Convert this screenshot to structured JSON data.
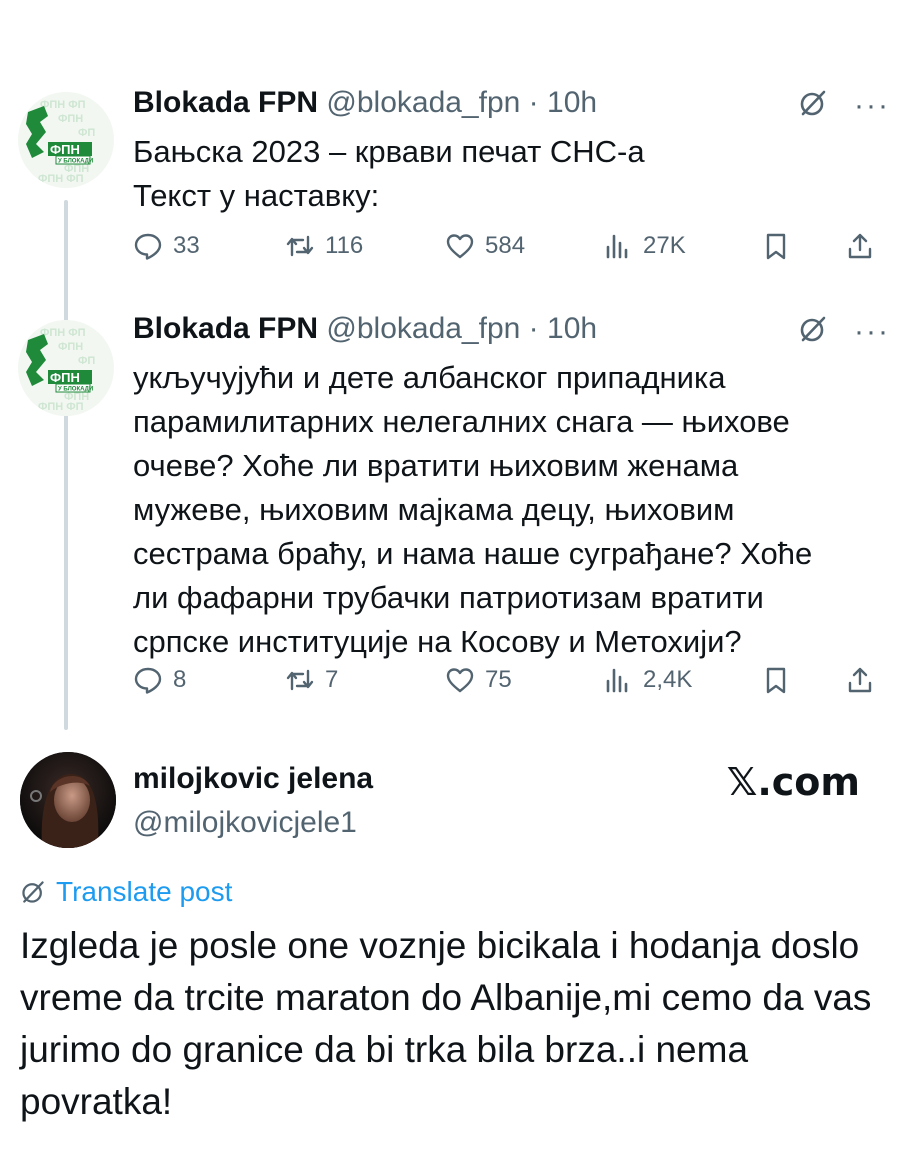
{
  "tweets": [
    {
      "name": "Blokada FPN",
      "handle": "@blokada_fpn",
      "separator": "·",
      "time": "10h",
      "avatar_text": "ФПН",
      "avatar_sub": "У БЛОКАДИ",
      "lines": [
        "Бањска 2023 – крвави печат СНС-а",
        "Текст у наставку:"
      ],
      "stats": {
        "replies": "33",
        "reposts": "116",
        "likes": "584",
        "views": "27K"
      }
    },
    {
      "name": "Blokada FPN",
      "handle": "@blokada_fpn",
      "separator": "·",
      "time": "10h",
      "avatar_text": "ФПН",
      "avatar_sub": "У БЛОКАДИ",
      "lines": [
        "укључујући и дете албанског припадника",
        "парамилитарних нелегалних снага — њихове",
        "очеве? Хоће ли вратити њиховим женама",
        "мужеве, њиховим мајкама децу, њиховим",
        "сестрама браћу, и нама наше суграђане? Хоће",
        "ли фафарни трубачки патриотизам вратити",
        "српске институције на Косову и Метохији?"
      ],
      "stats": {
        "replies": "8",
        "reposts": "7",
        "likes": "75",
        "views": "2,4K"
      }
    }
  ],
  "reply": {
    "name": "milojkovic jelena",
    "handle": "@milojkovicjele1",
    "brand": "𝕏.com",
    "translate_label": "Translate post",
    "lines": [
      "Izgleda je posle one voznje bicikala i hodanja doslo",
      "vreme da trcite maraton do Albanije,mi cemo da vas",
      "jurimo do granice da bi trka bila brza..i nema",
      "povratka!"
    ]
  },
  "icons": [
    "grok-icon",
    "more-icon",
    "reply-icon",
    "repost-icon",
    "like-icon",
    "views-icon",
    "bookmark-icon",
    "share-icon",
    "translate-icon"
  ],
  "colors": {
    "text": "#0f1419",
    "secondary": "#536471",
    "link": "#1d9bf0",
    "brand_green": "#1f8a3a",
    "thread_line": "#cfd9de"
  }
}
